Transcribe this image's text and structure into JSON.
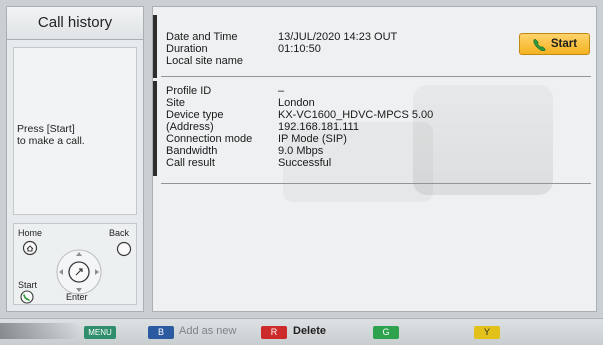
{
  "sidebar": {
    "title": "Call history",
    "hint": "Press [Start]\nto make a call.",
    "remote": {
      "home_label": "Home",
      "back_label": "Back",
      "start_label": "Start",
      "enter_label": "Enter"
    }
  },
  "details": {
    "header_rows": [
      {
        "key": "Date and Time",
        "value": "13/JUL/2020 14:23   OUT"
      },
      {
        "key": "Duration",
        "value": "01:10:50"
      },
      {
        "key": "Local site name",
        "value": ""
      }
    ],
    "info_rows": [
      {
        "key": "Profile ID",
        "value": "–"
      },
      {
        "key": "Site",
        "value": "London"
      },
      {
        "key": "Device type",
        "value": "KX-VC1600_HDVC-MPCS 5.00"
      },
      {
        "key": "(Address)",
        "value": "192.168.181.111"
      },
      {
        "key": "Connection mode",
        "value": "IP Mode (SIP)"
      },
      {
        "key": "Bandwidth",
        "value": "9.0 Mbps"
      },
      {
        "key": "Call result",
        "value": "Successful"
      }
    ],
    "start_button_label": "Start"
  },
  "function_keys": {
    "menu": "MENU",
    "blue_key": "B",
    "blue_label": "Add as new",
    "red_key": "R",
    "red_label": "Delete",
    "green_key": "G",
    "yellow_key": "Y"
  },
  "colors": {
    "start_button": "#f4b220",
    "menu_key": "#2f8f6c",
    "blue_key": "#2c5aa0",
    "red_key": "#cd2a2a",
    "green_key": "#2ea24c",
    "yellow_key": "#e2c21a"
  },
  "icons": {
    "start_button": "handset-icon",
    "remote_home": "home-key-icon",
    "remote_back": "back-key-icon",
    "remote_start": "start-key-icon",
    "remote_dpad": "dpad-icon"
  }
}
